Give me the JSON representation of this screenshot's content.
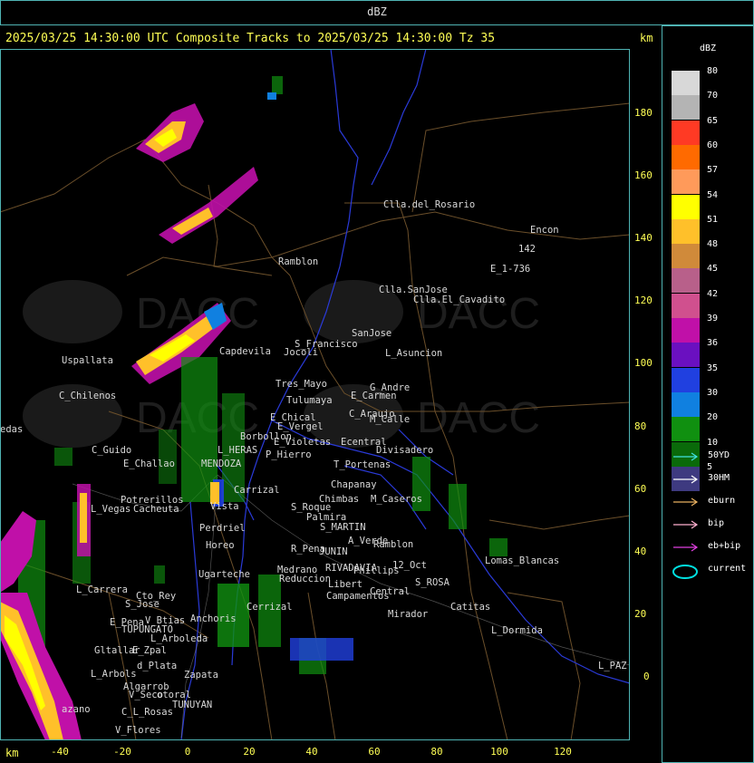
{
  "header": {
    "title": "dBZ"
  },
  "status": {
    "line": "2025/03/25 14:30:00 UTC Composite Tracks to 2025/03/25 14:30:00 Tz 35",
    "km_top": "km",
    "km_bottom": "km"
  },
  "axes": {
    "x_ticks": [
      "-40",
      "-20",
      "0",
      "20",
      "40",
      "60",
      "80",
      "100",
      "120"
    ],
    "y_ticks": [
      "180",
      "160",
      "140",
      "120",
      "100",
      "80",
      "60",
      "40",
      "20",
      "0"
    ]
  },
  "legend": {
    "title": "dBZ",
    "levels": [
      {
        "label": "80",
        "color": "#d8d8d8"
      },
      {
        "label": "70",
        "color": "#b4b4b4"
      },
      {
        "label": "65",
        "color": "#ff3a24"
      },
      {
        "label": "60",
        "color": "#ff6a00"
      },
      {
        "label": "57",
        "color": "#ff9a5a"
      },
      {
        "label": "54",
        "color": "#ffff00"
      },
      {
        "label": "51",
        "color": "#ffc02a"
      },
      {
        "label": "48",
        "color": "#d08a3a"
      },
      {
        "label": "45",
        "color": "#b8608a"
      },
      {
        "label": "42",
        "color": "#d0508e"
      },
      {
        "label": "39",
        "color": "#c010a8"
      },
      {
        "label": "36",
        "color": "#6a10c0"
      },
      {
        "label": "35",
        "color": "#2040e0"
      },
      {
        "label": "30",
        "color": "#1080e0"
      },
      {
        "label": "20",
        "color": "#109010"
      },
      {
        "label": "10",
        "color": "#0a6a0a"
      },
      {
        "label": "5",
        "color": "#3e3a80"
      }
    ],
    "tracks": [
      {
        "label": "50YD",
        "color": "#40e0e0",
        "icon": "arrow"
      },
      {
        "label": "30HM",
        "color": "#ffffff",
        "icon": "arrow"
      },
      {
        "label": "eburn",
        "color": "#e8b060",
        "icon": "arrow"
      },
      {
        "label": "bip",
        "color": "#ffb0d0",
        "icon": "arrow"
      },
      {
        "label": "eb+bip",
        "color": "#e040e0",
        "icon": "arrow"
      },
      {
        "label": "current",
        "color": "#00e0e0",
        "icon": "ellipse"
      }
    ]
  },
  "map": {
    "places": [
      "Clla.del_Rosario",
      "Encon",
      "142",
      "E_1-736",
      "Ramblon",
      "Clla.SanJose",
      "Clla.El_Cavadito",
      "Uspallata",
      "S_Francisco",
      "SanJose",
      "L_Asuncion",
      "Capdevila",
      "Jocoli",
      "Tres_Mayo",
      "G_Andre",
      "C_Chilenos",
      "Tulumaya",
      "E_Carmen",
      "E_Chical",
      "C_Araujo",
      "E_Vergel",
      "M_Calle",
      "edas",
      "Borbollon",
      "E_Violetas",
      "Ecentral",
      "Divisadero",
      "C_Guido",
      "L_HERAS",
      "P_Hierro",
      "E_Challao",
      "MENDOZA",
      "T_Portenas",
      "Chapanay",
      "Potrerillos",
      "L_Vegas",
      "Cacheuta",
      "S_Roque",
      "Chimbas",
      "M_Caseros",
      "Palmira",
      "Perdriel",
      "S_MARTIN",
      "A_Verde",
      "Ramblon",
      "Horeo",
      "R_Pena",
      "JUNIN",
      "12_Oct",
      "Lomas_Blancas",
      "Ugarteche",
      "RIVADAVIA",
      "Phillips",
      "Medrano",
      "Reduccion",
      "L_Carrera",
      "Cto_Rey",
      "S_Jose",
      "Libert",
      "Campamentos",
      "Central",
      "S_ROSA",
      "Catitas",
      "Cerrizal",
      "E_Pena",
      "V_Btias",
      "Anchoris",
      "TUPUNGATO",
      "L_Arboleda",
      "Mirador",
      "L_Dormida",
      "Gltallar",
      "E_Zpal",
      "d_Plata",
      "L_PAZ",
      "L_Arbols",
      "Zapata",
      "Algarrob",
      "V_Seco",
      "otoral",
      "TUNUYAN",
      "azano",
      "C_L_Rosas",
      "V_Flores",
      "Vista",
      "Carrizal"
    ]
  }
}
